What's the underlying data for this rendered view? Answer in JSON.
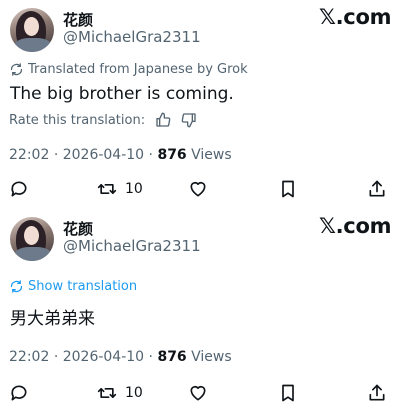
{
  "tweets": [
    {
      "display_name": "花颜",
      "handle": "@MichaelGra2311",
      "logo_text": "𝕏.com",
      "translation_note": "Translated from Japanese by Grok",
      "text": "The big brother is coming.",
      "rate_label": "Rate this translation:",
      "time": "22:02",
      "date": "2026-04-10",
      "views_count": "876",
      "views_label": "Views",
      "retweets": "10"
    },
    {
      "display_name": "花颜",
      "handle": "@MichaelGra2311",
      "logo_text": "𝕏.com",
      "show_translation": "Show translation",
      "text": "男大弟弟来",
      "time": "22:02",
      "date": "2026-04-10",
      "views_count": "876",
      "views_label": "Views",
      "retweets": "10"
    }
  ],
  "separator": "·",
  "colors": {
    "text": "#0f1419",
    "muted": "#536471",
    "link": "#1d9bf0"
  },
  "icons": [
    "translate-icon",
    "thumbs-up-icon",
    "thumbs-down-icon",
    "reply-icon",
    "retweet-icon",
    "like-icon",
    "bookmark-icon",
    "share-icon"
  ]
}
